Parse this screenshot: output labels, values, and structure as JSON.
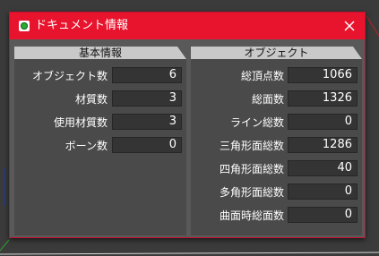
{
  "colors": {
    "titlebar": "#e8132c",
    "window_border": "#c8102e",
    "panel_bg": "#4a4a4a",
    "field_bg": "#343434",
    "header_bg": "#c9c9c9"
  },
  "window": {
    "title": "ドキュメント情報",
    "app_icon": "app-icon",
    "close_icon": "close-icon"
  },
  "basic": {
    "header": "基本情報",
    "rows": [
      {
        "label": "オブジェクト数",
        "value": "6"
      },
      {
        "label": "材質数",
        "value": "3"
      },
      {
        "label": "使用材質数",
        "value": "3"
      },
      {
        "label": "ボーン数",
        "value": "0"
      }
    ]
  },
  "object": {
    "header": "オブジェクト",
    "rows": [
      {
        "label": "総頂点数",
        "value": "1066"
      },
      {
        "label": "総面数",
        "value": "1326"
      },
      {
        "label": "ライン総数",
        "value": "0"
      },
      {
        "label": "三角形面総数",
        "value": "1286"
      },
      {
        "label": "四角形面総数",
        "value": "40"
      },
      {
        "label": "多角形面総数",
        "value": "0"
      },
      {
        "label": "曲面時総面数",
        "value": "0"
      }
    ]
  }
}
